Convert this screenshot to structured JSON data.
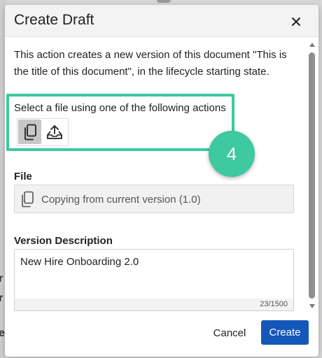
{
  "dialog": {
    "title": "Create Draft",
    "close_icon": "close-icon"
  },
  "description": "This action creates a new version of this document \"This is the title of this document\", in the lifecycle starting state.",
  "file_source": {
    "label": "Select a file using one of the following actions",
    "actions": [
      {
        "icon": "copy-icon",
        "selected": true
      },
      {
        "icon": "upload-icon",
        "selected": false
      }
    ]
  },
  "step_badge": "4",
  "file": {
    "label": "File",
    "icon": "copy-icon",
    "value": "Copying from current version (1.0)"
  },
  "version_description": {
    "label": "Version Description",
    "value": "New Hire Onboarding 2.0",
    "counter": "23/1500"
  },
  "footer": {
    "cancel_label": "Cancel",
    "create_label": "Create"
  },
  "colors": {
    "accent": "#3ec9a0",
    "primary_button": "#1557b8"
  }
}
